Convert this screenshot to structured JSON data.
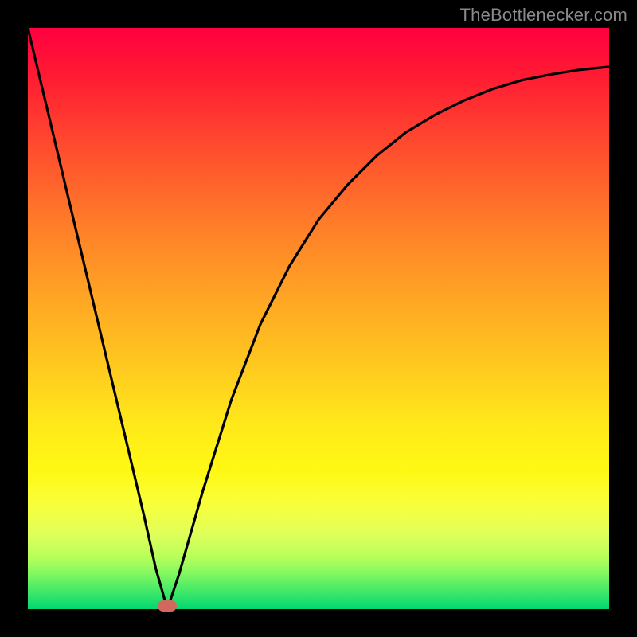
{
  "watermark": "TheBottlenecker.com",
  "colors": {
    "frame": "#000000",
    "curve": "#000000",
    "marker": "#d2695e"
  },
  "chart_data": {
    "type": "line",
    "title": "",
    "xlabel": "",
    "ylabel": "",
    "xlim": [
      0,
      100
    ],
    "ylim": [
      0,
      100
    ],
    "grid": false,
    "legend": false,
    "series": [
      {
        "name": "bottleneck-curve",
        "x": [
          0,
          5,
          10,
          15,
          20,
          22,
          24,
          26,
          30,
          35,
          40,
          45,
          50,
          55,
          60,
          65,
          70,
          75,
          80,
          85,
          90,
          95,
          100
        ],
        "y": [
          100,
          79,
          58,
          37,
          16,
          7,
          0,
          6,
          20,
          36,
          49,
          59,
          67,
          73,
          78,
          82,
          85,
          87.5,
          89.5,
          91,
          92,
          92.8,
          93.3
        ]
      }
    ],
    "annotations": [
      {
        "name": "min-marker",
        "x": 24,
        "y": 0.5
      }
    ]
  }
}
